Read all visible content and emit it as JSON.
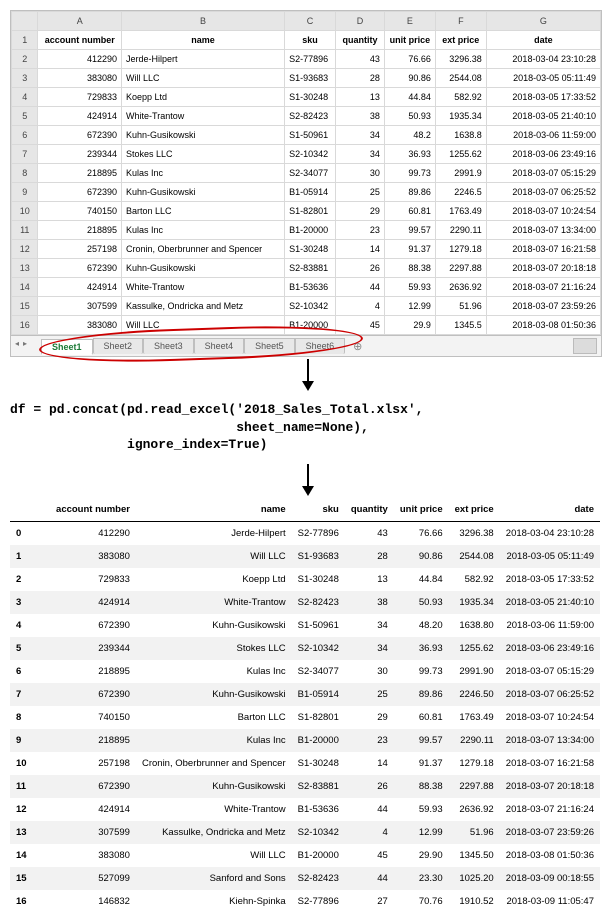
{
  "excel": {
    "columns": [
      "A",
      "B",
      "C",
      "D",
      "E",
      "F",
      "G"
    ],
    "headers": [
      "account number",
      "name",
      "sku",
      "quantity",
      "unit price",
      "ext price",
      "date"
    ],
    "sheet_tabs": [
      "Sheet1",
      "Sheet2",
      "Sheet3",
      "Sheet4",
      "Sheet5",
      "Sheet6"
    ],
    "active_tab": "Sheet1",
    "rows": [
      {
        "r": 2,
        "acc": "412290",
        "name": "Jerde-Hilpert",
        "sku": "S2-77896",
        "qty": "43",
        "unit": "76.66",
        "ext": "3296.38",
        "date": "2018-03-04 23:10:28"
      },
      {
        "r": 3,
        "acc": "383080",
        "name": "Will LLC",
        "sku": "S1-93683",
        "qty": "28",
        "unit": "90.86",
        "ext": "2544.08",
        "date": "2018-03-05 05:11:49"
      },
      {
        "r": 4,
        "acc": "729833",
        "name": "Koepp Ltd",
        "sku": "S1-30248",
        "qty": "13",
        "unit": "44.84",
        "ext": "582.92",
        "date": "2018-03-05 17:33:52"
      },
      {
        "r": 5,
        "acc": "424914",
        "name": "White-Trantow",
        "sku": "S2-82423",
        "qty": "38",
        "unit": "50.93",
        "ext": "1935.34",
        "date": "2018-03-05 21:40:10"
      },
      {
        "r": 6,
        "acc": "672390",
        "name": "Kuhn-Gusikowski",
        "sku": "S1-50961",
        "qty": "34",
        "unit": "48.2",
        "ext": "1638.8",
        "date": "2018-03-06 11:59:00"
      },
      {
        "r": 7,
        "acc": "239344",
        "name": "Stokes LLC",
        "sku": "S2-10342",
        "qty": "34",
        "unit": "36.93",
        "ext": "1255.62",
        "date": "2018-03-06 23:49:16"
      },
      {
        "r": 8,
        "acc": "218895",
        "name": "Kulas Inc",
        "sku": "S2-34077",
        "qty": "30",
        "unit": "99.73",
        "ext": "2991.9",
        "date": "2018-03-07 05:15:29"
      },
      {
        "r": 9,
        "acc": "672390",
        "name": "Kuhn-Gusikowski",
        "sku": "B1-05914",
        "qty": "25",
        "unit": "89.86",
        "ext": "2246.5",
        "date": "2018-03-07 06:25:52"
      },
      {
        "r": 10,
        "acc": "740150",
        "name": "Barton LLC",
        "sku": "S1-82801",
        "qty": "29",
        "unit": "60.81",
        "ext": "1763.49",
        "date": "2018-03-07 10:24:54"
      },
      {
        "r": 11,
        "acc": "218895",
        "name": "Kulas Inc",
        "sku": "B1-20000",
        "qty": "23",
        "unit": "99.57",
        "ext": "2290.11",
        "date": "2018-03-07 13:34:00"
      },
      {
        "r": 12,
        "acc": "257198",
        "name": "Cronin, Oberbrunner and Spencer",
        "sku": "S1-30248",
        "qty": "14",
        "unit": "91.37",
        "ext": "1279.18",
        "date": "2018-03-07 16:21:58"
      },
      {
        "r": 13,
        "acc": "672390",
        "name": "Kuhn-Gusikowski",
        "sku": "S2-83881",
        "qty": "26",
        "unit": "88.38",
        "ext": "2297.88",
        "date": "2018-03-07 20:18:18"
      },
      {
        "r": 14,
        "acc": "424914",
        "name": "White-Trantow",
        "sku": "B1-53636",
        "qty": "44",
        "unit": "59.93",
        "ext": "2636.92",
        "date": "2018-03-07 21:16:24"
      },
      {
        "r": 15,
        "acc": "307599",
        "name": "Kassulke, Ondricka and Metz",
        "sku": "S2-10342",
        "qty": "4",
        "unit": "12.99",
        "ext": "51.96",
        "date": "2018-03-07 23:59:26"
      },
      {
        "r": 16,
        "acc": "383080",
        "name": "Will LLC",
        "sku": "B1-20000",
        "qty": "45",
        "unit": "29.9",
        "ext": "1345.5",
        "date": "2018-03-08 01:50:36"
      }
    ]
  },
  "code": {
    "line1": "df = pd.concat(pd.read_excel('2018_Sales_Total.xlsx',",
    "line2": "                             sheet_name=None),",
    "line3": "               ignore_index=True)"
  },
  "df": {
    "headers": [
      "account number",
      "name",
      "sku",
      "quantity",
      "unit price",
      "ext price",
      "date"
    ],
    "rows": [
      {
        "i": "0",
        "acc": "412290",
        "name": "Jerde-Hilpert",
        "sku": "S2-77896",
        "qty": "43",
        "unit": "76.66",
        "ext": "3296.38",
        "date": "2018-03-04 23:10:28"
      },
      {
        "i": "1",
        "acc": "383080",
        "name": "Will LLC",
        "sku": "S1-93683",
        "qty": "28",
        "unit": "90.86",
        "ext": "2544.08",
        "date": "2018-03-05 05:11:49"
      },
      {
        "i": "2",
        "acc": "729833",
        "name": "Koepp Ltd",
        "sku": "S1-30248",
        "qty": "13",
        "unit": "44.84",
        "ext": "582.92",
        "date": "2018-03-05 17:33:52"
      },
      {
        "i": "3",
        "acc": "424914",
        "name": "White-Trantow",
        "sku": "S2-82423",
        "qty": "38",
        "unit": "50.93",
        "ext": "1935.34",
        "date": "2018-03-05 21:40:10"
      },
      {
        "i": "4",
        "acc": "672390",
        "name": "Kuhn-Gusikowski",
        "sku": "S1-50961",
        "qty": "34",
        "unit": "48.20",
        "ext": "1638.80",
        "date": "2018-03-06 11:59:00"
      },
      {
        "i": "5",
        "acc": "239344",
        "name": "Stokes LLC",
        "sku": "S2-10342",
        "qty": "34",
        "unit": "36.93",
        "ext": "1255.62",
        "date": "2018-03-06 23:49:16"
      },
      {
        "i": "6",
        "acc": "218895",
        "name": "Kulas Inc",
        "sku": "S2-34077",
        "qty": "30",
        "unit": "99.73",
        "ext": "2991.90",
        "date": "2018-03-07 05:15:29"
      },
      {
        "i": "7",
        "acc": "672390",
        "name": "Kuhn-Gusikowski",
        "sku": "B1-05914",
        "qty": "25",
        "unit": "89.86",
        "ext": "2246.50",
        "date": "2018-03-07 06:25:52"
      },
      {
        "i": "8",
        "acc": "740150",
        "name": "Barton LLC",
        "sku": "S1-82801",
        "qty": "29",
        "unit": "60.81",
        "ext": "1763.49",
        "date": "2018-03-07 10:24:54"
      },
      {
        "i": "9",
        "acc": "218895",
        "name": "Kulas Inc",
        "sku": "B1-20000",
        "qty": "23",
        "unit": "99.57",
        "ext": "2290.11",
        "date": "2018-03-07 13:34:00"
      },
      {
        "i": "10",
        "acc": "257198",
        "name": "Cronin, Oberbrunner and Spencer",
        "sku": "S1-30248",
        "qty": "14",
        "unit": "91.37",
        "ext": "1279.18",
        "date": "2018-03-07 16:21:58"
      },
      {
        "i": "11",
        "acc": "672390",
        "name": "Kuhn-Gusikowski",
        "sku": "S2-83881",
        "qty": "26",
        "unit": "88.38",
        "ext": "2297.88",
        "date": "2018-03-07 20:18:18"
      },
      {
        "i": "12",
        "acc": "424914",
        "name": "White-Trantow",
        "sku": "B1-53636",
        "qty": "44",
        "unit": "59.93",
        "ext": "2636.92",
        "date": "2018-03-07 21:16:24"
      },
      {
        "i": "13",
        "acc": "307599",
        "name": "Kassulke, Ondricka and Metz",
        "sku": "S2-10342",
        "qty": "4",
        "unit": "12.99",
        "ext": "51.96",
        "date": "2018-03-07 23:59:26"
      },
      {
        "i": "14",
        "acc": "383080",
        "name": "Will LLC",
        "sku": "B1-20000",
        "qty": "45",
        "unit": "29.90",
        "ext": "1345.50",
        "date": "2018-03-08 01:50:36"
      },
      {
        "i": "15",
        "acc": "527099",
        "name": "Sanford and Sons",
        "sku": "S2-82423",
        "qty": "44",
        "unit": "23.30",
        "ext": "1025.20",
        "date": "2018-03-09 00:18:55"
      },
      {
        "i": "16",
        "acc": "146832",
        "name": "Kiehn-Spinka",
        "sku": "S2-77896",
        "qty": "27",
        "unit": "70.76",
        "ext": "1910.52",
        "date": "2018-03-09 11:05:47"
      }
    ]
  }
}
